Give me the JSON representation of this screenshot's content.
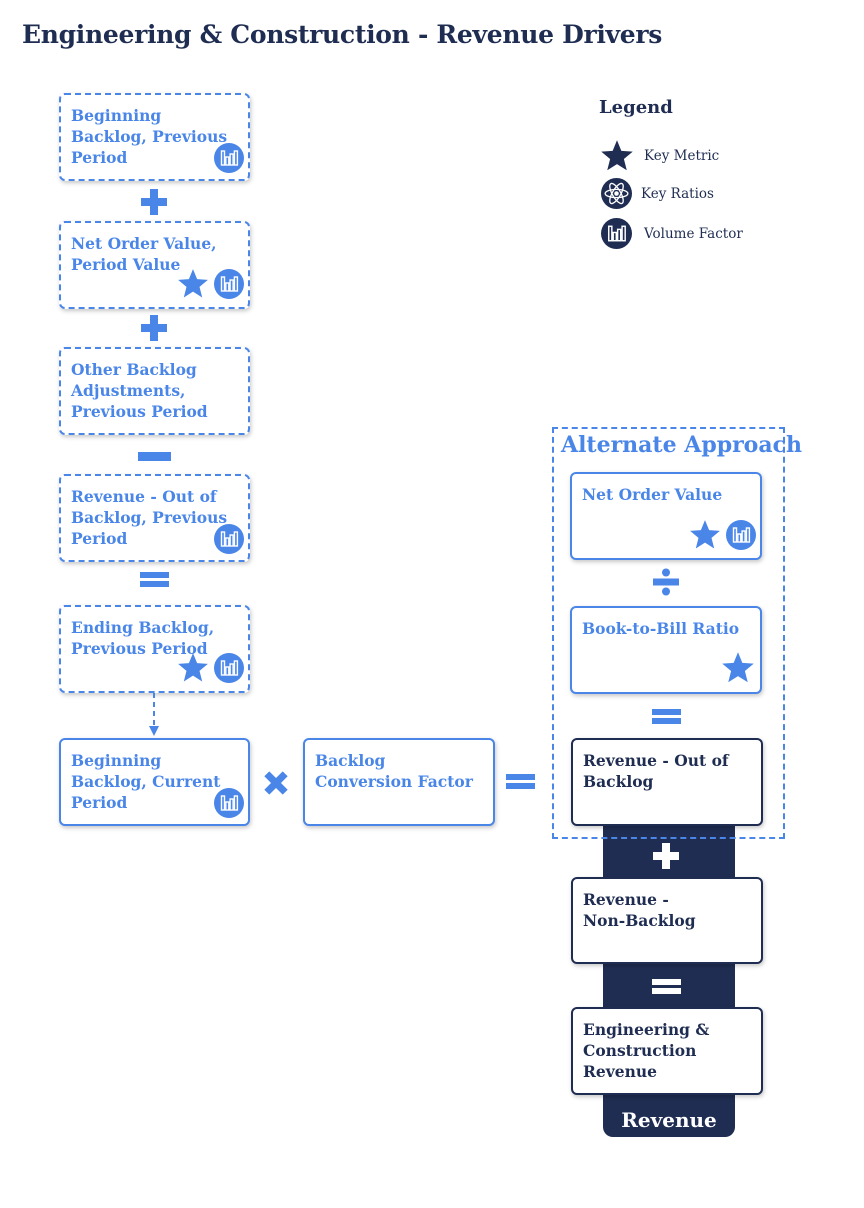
{
  "title": "Engineering & Construction - Revenue Drivers",
  "colors": {
    "accent_blue": "#4a86e8",
    "navy": "#1f2d52",
    "background": "#ffffff"
  },
  "legend": {
    "title": "Legend",
    "items": [
      {
        "icon": "star-icon",
        "label": "Key Metric"
      },
      {
        "icon": "atom-icon",
        "label": "Key Ratios"
      },
      {
        "icon": "bar-chart-icon",
        "label": "Volume Factor"
      }
    ]
  },
  "left_column": [
    {
      "label": "Beginning Backlog, Previous Period",
      "style": "dashed",
      "icons": [
        "bar-chart-icon"
      ]
    },
    {
      "operator": "plus"
    },
    {
      "label": "Net Order Value, Period Value",
      "style": "dashed",
      "icons": [
        "star-icon",
        "bar-chart-icon"
      ]
    },
    {
      "operator": "plus"
    },
    {
      "label": "Other Backlog Adjustments, Previous Period",
      "style": "dashed",
      "icons": []
    },
    {
      "operator": "minus"
    },
    {
      "label": "Revenue - Out of Backlog, Previous Period",
      "style": "dashed",
      "icons": [
        "bar-chart-icon"
      ]
    },
    {
      "operator": "equals"
    },
    {
      "label": "Ending Backlog, Previous Period",
      "style": "dashed",
      "icons": [
        "star-icon",
        "bar-chart-icon"
      ]
    },
    {
      "connector": "dashed-arrow-down"
    },
    {
      "label": "Beginning Backlog, Current Period",
      "style": "solid",
      "icons": [
        "bar-chart-icon"
      ]
    }
  ],
  "middle_row": {
    "multiply_operator": "times",
    "conversion_factor": {
      "label": "Backlog Conversion Factor",
      "icons": []
    },
    "equals_operator": "equals"
  },
  "alternate_approach": {
    "title": "Alternate Approach",
    "items": [
      {
        "label": "Net Order Value",
        "icons": [
          "star-icon",
          "bar-chart-icon"
        ]
      },
      {
        "operator": "divide"
      },
      {
        "label": "Book-to-Bill Ratio",
        "icons": [
          "star-icon"
        ]
      },
      {
        "operator": "equals"
      },
      {
        "label": "Revenue - Out of Backlog",
        "icons": []
      }
    ]
  },
  "revenue_column": {
    "items": [
      {
        "operator": "plus"
      },
      {
        "label": "Revenue - Non-Backlog"
      },
      {
        "operator": "equals"
      },
      {
        "label": "Engineering & Construction Revenue"
      }
    ],
    "footer_label": "Revenue"
  },
  "labels": {
    "b1": "Beginning Backlog, Previous Period",
    "b2": "Net Order Value, Period Value",
    "b3": "Other Backlog Adjustments, Previous Period",
    "b4": "Revenue - Out of Backlog, Previous Period",
    "b5": "Ending Backlog, Previous Period",
    "b6": "Beginning Backlog, Current Period",
    "conv": "Backlog Conversion Factor",
    "alt_nov": "Net Order Value",
    "alt_btb": "Book-to-Bill Ratio",
    "rev_oob": "Revenue - Out of Backlog",
    "rev_nb": "Revenue - Non-Backlog",
    "ec_rev": "Engineering & Construction Revenue"
  }
}
